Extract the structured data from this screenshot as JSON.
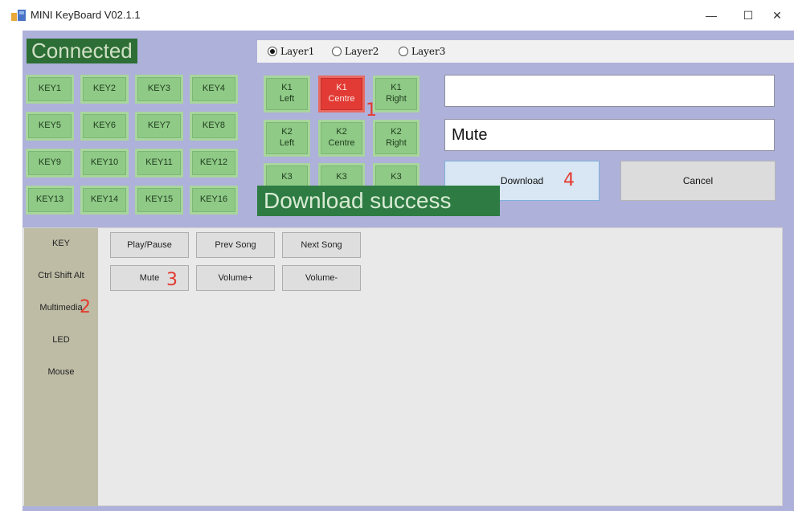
{
  "window": {
    "title": "MINI KeyBoard V02.1.1",
    "minimize_icon": "—",
    "maximize_icon": "☐",
    "close_icon": "✕"
  },
  "status": {
    "label": "Connected",
    "color": "#2c6e35"
  },
  "layers": [
    {
      "label": "Layer1",
      "selected": true
    },
    {
      "label": "Layer2",
      "selected": false
    },
    {
      "label": "Layer3",
      "selected": false
    }
  ],
  "keys": [
    "KEY1",
    "KEY2",
    "KEY3",
    "KEY4",
    "KEY5",
    "KEY6",
    "KEY7",
    "KEY8",
    "KEY9",
    "KEY10",
    "KEY11",
    "KEY12",
    "KEY13",
    "KEY14",
    "KEY15",
    "KEY16"
  ],
  "knobs": [
    {
      "label": "K1\nLeft",
      "active": false
    },
    {
      "label": "K1\nCentre",
      "active": true
    },
    {
      "label": "K1\nRight",
      "active": false
    },
    {
      "label": "K2\nLeft",
      "active": false
    },
    {
      "label": "K2\nCentre",
      "active": false
    },
    {
      "label": "K2\nRight",
      "active": false
    },
    {
      "label": "K3",
      "active": false
    },
    {
      "label": "K3",
      "active": false
    },
    {
      "label": "K3",
      "active": false
    }
  ],
  "inputs": {
    "key_value": "",
    "function_value": "Mute"
  },
  "actions": {
    "download": "Download",
    "cancel": "Cancel"
  },
  "toast": "Download success",
  "sidebar": [
    "KEY",
    "Ctrl Shift Alt",
    "Multimedia",
    "LED",
    "Mouse"
  ],
  "media_buttons": [
    "Play/Pause",
    "Prev Song",
    "Next Song",
    "Mute",
    "Volume+",
    "Volume-"
  ],
  "markers": [
    "1",
    "2",
    "3",
    "4"
  ],
  "colors": {
    "key_green": "#8fca87",
    "key_selected": "#e23b35",
    "toast_green": "#2e7c43",
    "window_bg": "#aeb1d9"
  }
}
